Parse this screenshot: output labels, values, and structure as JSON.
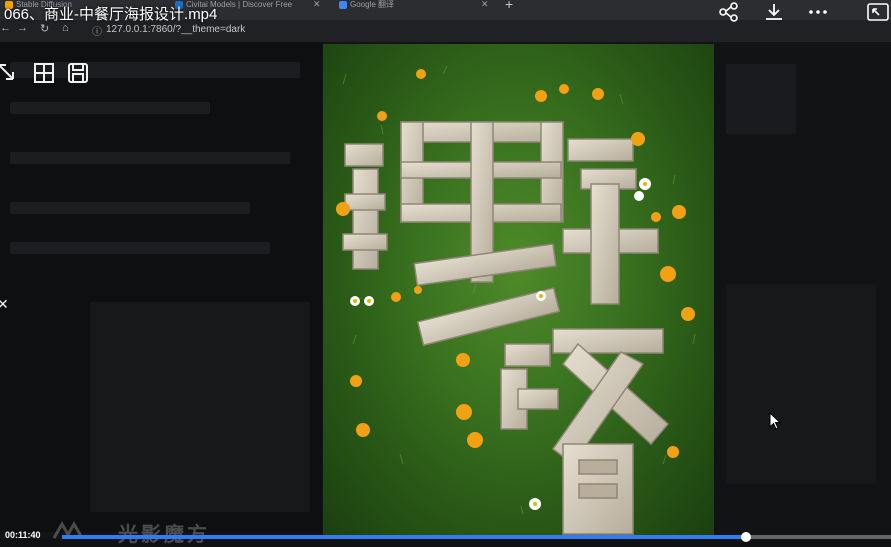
{
  "video": {
    "title": "066、商业-中餐厅海报设计.mp4",
    "time": "00:11:40",
    "progress": 0.825,
    "watermark": "光影魔方"
  },
  "browser": {
    "tabs": [
      {
        "label": "Stable Diffusion",
        "color": "#f4a300"
      },
      {
        "label": "Civitai Models | Discover Free",
        "color": "#1971c2"
      },
      {
        "label": "Google 翻译",
        "color": "#4285f4"
      }
    ],
    "new_tab": "+",
    "url": "127.0.0.1:7860/?__theme=dark"
  },
  "poster": {
    "line1": "野",
    "line2": "餐"
  },
  "colors": {
    "accent": "#2f7cf6",
    "grass": "#3b7420",
    "stone": "#cfc6b6"
  }
}
